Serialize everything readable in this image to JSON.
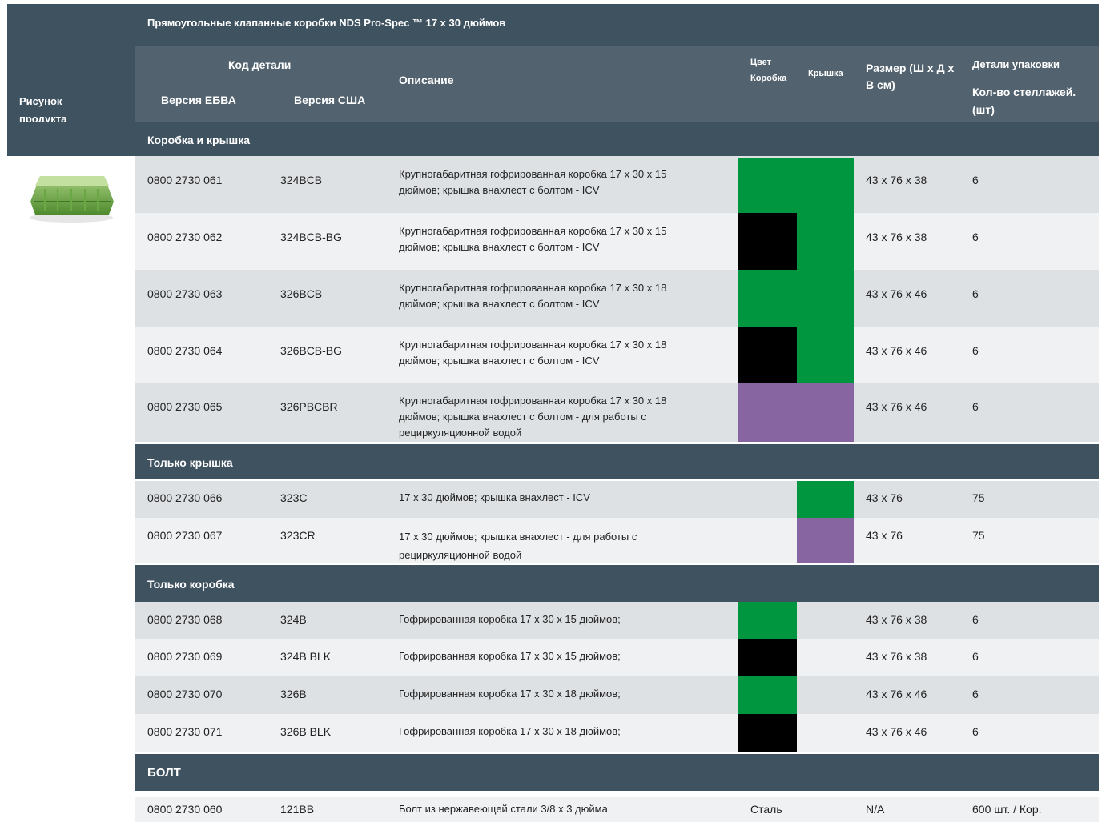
{
  "table_title": "Прямоугольные клапанные коробки NDS Pro-Spec ™ 17 x 30 дюймов",
  "headers": {
    "product_image": "Рисунок продукта",
    "part_code": "Код детали",
    "ebva": "Версия ЕБВА",
    "usa": "Версия США",
    "description": "Описание",
    "color": "Цвет",
    "color_box": "Коробка",
    "color_lid": "Крышка",
    "size": "Размер (Ш x Д x В см)",
    "packaging": "Детали упаковки",
    "qty": "Кол-во стеллажей. (шт)"
  },
  "colors": {
    "green": "#00963f",
    "black": "#000000",
    "purple": "#8765a0",
    "header_dark": "#3f5260",
    "header_mid": "#52636f"
  },
  "sections": [
    {
      "title": "Коробка и крышка",
      "rows": [
        {
          "ebva": "0800 2730 061",
          "usa": "324BCB",
          "desc": "Крупногабаритная гофрированная коробка 17 x 30 x 15 дюймов; крышка внахлест с болтом - ICV",
          "box": "green",
          "lid": "green",
          "size": "43 x 76 x 38",
          "qty": "6"
        },
        {
          "ebva": "0800 2730 062",
          "usa": "324BCB-BG",
          "desc": "Крупногабаритная гофрированная коробка 17 x 30 x 15 дюймов; крышка внахлест с болтом - ICV",
          "box": "black",
          "lid": "green",
          "size": "43 x 76 x 38",
          "qty": "6"
        },
        {
          "ebva": "0800 2730 063",
          "usa": "326BCB",
          "desc": "Крупногабаритная гофрированная коробка 17 x 30 x 18 дюймов; крышка внахлест с болтом - ICV",
          "box": "green",
          "lid": "green",
          "size": "43 x 76 x 46",
          "qty": "6"
        },
        {
          "ebva": "0800 2730 064",
          "usa": "326BCB-BG",
          "desc": "Крупногабаритная гофрированная коробка 17 x 30 x 18 дюймов; крышка внахлест с болтом - ICV",
          "box": "black",
          "lid": "green",
          "size": "43 x 76 x 46",
          "qty": "6"
        },
        {
          "ebva": "0800 2730 065",
          "usa": "326PBCBR",
          "desc": "Крупногабаритная гофрированная коробка 17 x 30 x 18 дюймов; крышка внахлест с болтом - для работы с рециркуляционной водой",
          "box": "purple",
          "lid": "purple",
          "size": "43 x 76 x 46",
          "qty": "6"
        }
      ]
    },
    {
      "title": "Только крышка",
      "rows": [
        {
          "ebva": "0800 2730 066",
          "usa": "323C",
          "desc": "17 x 30 дюймов; крышка внахлест - ICV",
          "box": "",
          "lid": "green",
          "size": "43 x 76",
          "qty": "75"
        },
        {
          "ebva": "0800 2730 067",
          "usa": "323CR",
          "desc": "17 x 30 дюймов; крышка внахлест - для работы с рециркуляционной водой",
          "box": "",
          "lid": "purple",
          "size": "43 x 76",
          "qty": "75"
        }
      ]
    },
    {
      "title": "Только коробка",
      "rows": [
        {
          "ebva": "0800 2730 068",
          "usa": "324B",
          "desc": "Гофрированная коробка 17 x 30 x 15 дюймов;",
          "box": "green",
          "lid": "",
          "size": "43 x 76 x 38",
          "qty": "6"
        },
        {
          "ebva": "0800 2730 069",
          "usa": "324B BLK",
          "desc": "Гофрированная коробка 17 x 30 x 15 дюймов;",
          "box": "black",
          "lid": "",
          "size": "43 x 76 x 38",
          "qty": "6"
        },
        {
          "ebva": "0800 2730 070",
          "usa": "326B",
          "desc": "Гофрированная коробка 17 x 30 x 18 дюймов;",
          "box": "green",
          "lid": "",
          "size": "43 x 76 x 46",
          "qty": "6"
        },
        {
          "ebva": "0800 2730 071",
          "usa": "326B BLK",
          "desc": "Гофрированная коробка 17 x 30 x 18 дюймов;",
          "box": "black",
          "lid": "",
          "size": "43 x 76 x 46",
          "qty": "6"
        }
      ]
    },
    {
      "title": "БОЛТ",
      "rows": [
        {
          "ebva": "0800 2730 060",
          "usa": "121BB",
          "desc": "Болт из нержавеющей стали 3/8 x 3 дюйма",
          "color_text": "Сталь",
          "size": "N/A",
          "qty": "600 шт. / Кор."
        }
      ]
    }
  ]
}
